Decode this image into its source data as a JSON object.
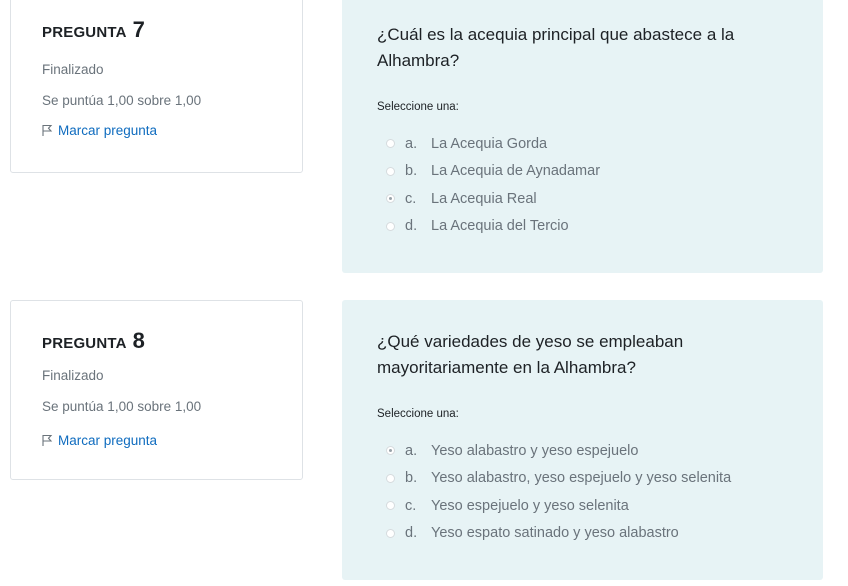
{
  "questions": [
    {
      "label": "PREGUNTA",
      "number": "7",
      "state": "Finalizado",
      "grade": "Se puntúa 1,00 sobre 1,00",
      "flag_label": "Marcar pregunta",
      "text": "¿Cuál es la acequia principal que abastece a la Alhambra?",
      "prompt": "Seleccione una:",
      "answers": [
        {
          "letter": "a.",
          "text": "La Acequia Gorda",
          "selected": false
        },
        {
          "letter": "b.",
          "text": "La Acequia de Aynadamar",
          "selected": false
        },
        {
          "letter": "c.",
          "text": "La Acequia Real",
          "selected": true
        },
        {
          "letter": "d.",
          "text": "La Acequia del Tercio",
          "selected": false
        }
      ]
    },
    {
      "label": "PREGUNTA",
      "number": "8",
      "state": "Finalizado",
      "grade": "Se puntúa 1,00 sobre 1,00",
      "flag_label": "Marcar pregunta",
      "text": "¿Qué variedades de yeso se empleaban mayoritariamente en la Alhambra?",
      "prompt": "Seleccione una:",
      "answers": [
        {
          "letter": "a.",
          "text": "Yeso alabastro y yeso espejuelo",
          "selected": true
        },
        {
          "letter": "b.",
          "text": "Yeso alabastro, yeso espejuelo y yeso selenita",
          "selected": false
        },
        {
          "letter": "c.",
          "text": "Yeso espejuelo y yeso selenita",
          "selected": false
        },
        {
          "letter": "d.",
          "text": "Yeso espato satinado y yeso alabastro",
          "selected": false
        }
      ]
    }
  ],
  "colors": {
    "content_bg": "#e7f3f5",
    "link": "#0f6cbf",
    "muted": "#6a737b"
  }
}
